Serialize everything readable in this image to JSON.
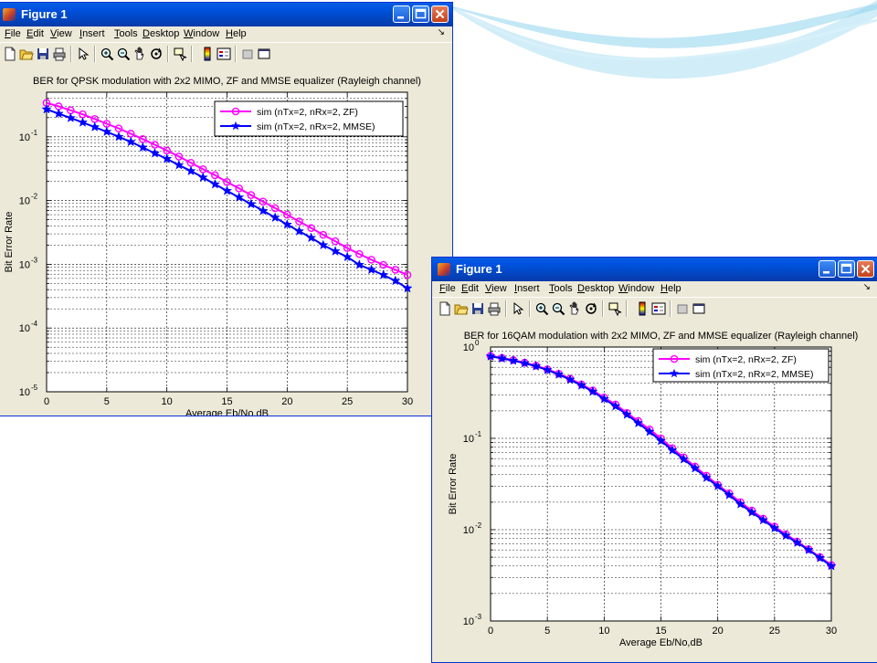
{
  "colors": {
    "zf_series": "#ff00ff",
    "mmse_series": "#0000ff",
    "titlebar": "#0054e3",
    "window_face": "#ece9d8",
    "background": "#ffffff",
    "swoosh": "#8fd3ec"
  },
  "menu_items": [
    "File",
    "Edit",
    "View",
    "Insert",
    "Tools",
    "Desktop",
    "Window",
    "Help"
  ],
  "toolbar_icons": [
    "new-figure-icon",
    "open-file-icon",
    "save-icon",
    "print-icon",
    "edit-plot-arrow-icon",
    "zoom-in-icon",
    "zoom-out-icon",
    "pan-icon",
    "rotate-3d-icon",
    "data-cursor-icon",
    "colorbar-icon",
    "legend-icon",
    "hide-plot-tools-icon",
    "show-plot-tools-icon"
  ],
  "windows": [
    {
      "title": "Figure 1"
    },
    {
      "title": "Figure 1"
    }
  ],
  "chart_data": [
    {
      "type": "line",
      "title": "BER for QPSK modulation with 2x2 MIMO,  ZF and MMSE equalizer (Rayleigh channel)",
      "xlabel": "Average Eb/No,dB",
      "ylabel": "Bit Error Rate",
      "xlim": [
        0,
        30
      ],
      "ylim": [
        1e-05,
        0.5
      ],
      "yscale": "log",
      "grid": true,
      "legend_position": "top-right",
      "x_ticks": [
        "0",
        "5",
        "10",
        "15",
        "20",
        "25",
        "30"
      ],
      "y_ticks": [
        {
          "base": "10",
          "exp": "-1",
          "value": 0.1
        },
        {
          "base": "10",
          "exp": "-2",
          "value": 0.01
        },
        {
          "base": "10",
          "exp": "-3",
          "value": 0.001
        },
        {
          "base": "10",
          "exp": "-4",
          "value": 0.0001
        },
        {
          "base": "10",
          "exp": "-5",
          "value": 1e-05
        }
      ],
      "x": [
        0,
        1,
        2,
        3,
        4,
        5,
        6,
        7,
        8,
        9,
        10,
        11,
        12,
        13,
        14,
        15,
        16,
        17,
        18,
        19,
        20,
        21,
        22,
        23,
        24,
        25,
        26,
        27,
        28,
        29,
        30
      ],
      "series": [
        {
          "name": "sim (nTx=2, nRx=2, ZF)",
          "marker": "circle",
          "values": [
            0.34,
            0.3,
            0.26,
            0.225,
            0.19,
            0.16,
            0.135,
            0.112,
            0.092,
            0.075,
            0.061,
            0.049,
            0.039,
            0.031,
            0.025,
            0.0195,
            0.0155,
            0.0122,
            0.0096,
            0.0076,
            0.006,
            0.0047,
            0.0037,
            0.0029,
            0.0023,
            0.0018,
            0.00145,
            0.00118,
            0.00098,
            0.00082,
            0.00068
          ]
        },
        {
          "name": "sim (nTx=2, nRx=2, MMSE)",
          "marker": "pentagram",
          "values": [
            0.27,
            0.23,
            0.197,
            0.168,
            0.142,
            0.12,
            0.1,
            0.083,
            0.068,
            0.055,
            0.045,
            0.036,
            0.029,
            0.023,
            0.018,
            0.0142,
            0.0112,
            0.0088,
            0.0069,
            0.0054,
            0.0042,
            0.0033,
            0.0026,
            0.002,
            0.0016,
            0.0013,
            0.00098,
            0.00082,
            0.00068,
            0.00055,
            0.00042
          ]
        }
      ]
    },
    {
      "type": "line",
      "title": "BER for 16QAM modulation with 2x2 MIMO,  ZF and MMSE equalizer (Rayleigh channel)",
      "xlabel": "Average Eb/No,dB",
      "ylabel": "Bit Error Rate",
      "xlim": [
        0,
        30
      ],
      "ylim": [
        0.001,
        1
      ],
      "yscale": "log",
      "grid": true,
      "legend_position": "top-right",
      "x_ticks": [
        "0",
        "5",
        "10",
        "15",
        "20",
        "25",
        "30"
      ],
      "y_ticks": [
        {
          "base": "10",
          "exp": "0",
          "value": 1
        },
        {
          "base": "10",
          "exp": "-1",
          "value": 0.1
        },
        {
          "base": "10",
          "exp": "-2",
          "value": 0.01
        },
        {
          "base": "10",
          "exp": "-3",
          "value": 0.001
        }
      ],
      "x": [
        0,
        1,
        2,
        3,
        4,
        5,
        6,
        7,
        8,
        9,
        10,
        11,
        12,
        13,
        14,
        15,
        16,
        17,
        18,
        19,
        20,
        21,
        22,
        23,
        24,
        25,
        26,
        27,
        28,
        29,
        30
      ],
      "series": [
        {
          "name": "sim (nTx=2, nRx=2, ZF)",
          "marker": "circle",
          "values": [
            0.8,
            0.76,
            0.72,
            0.675,
            0.625,
            0.57,
            0.51,
            0.45,
            0.39,
            0.335,
            0.28,
            0.235,
            0.19,
            0.155,
            0.125,
            0.1,
            0.078,
            0.062,
            0.049,
            0.039,
            0.031,
            0.025,
            0.02,
            0.0162,
            0.0132,
            0.0108,
            0.0089,
            0.0074,
            0.0061,
            0.005,
            0.0041
          ]
        },
        {
          "name": "sim (nTx=2, nRx=2, MMSE)",
          "marker": "pentagram",
          "values": [
            0.79,
            0.75,
            0.71,
            0.665,
            0.615,
            0.56,
            0.5,
            0.44,
            0.38,
            0.325,
            0.27,
            0.225,
            0.182,
            0.147,
            0.118,
            0.094,
            0.074,
            0.059,
            0.047,
            0.037,
            0.03,
            0.024,
            0.019,
            0.0155,
            0.0127,
            0.0104,
            0.0086,
            0.0072,
            0.006,
            0.0049,
            0.004
          ]
        }
      ]
    }
  ]
}
